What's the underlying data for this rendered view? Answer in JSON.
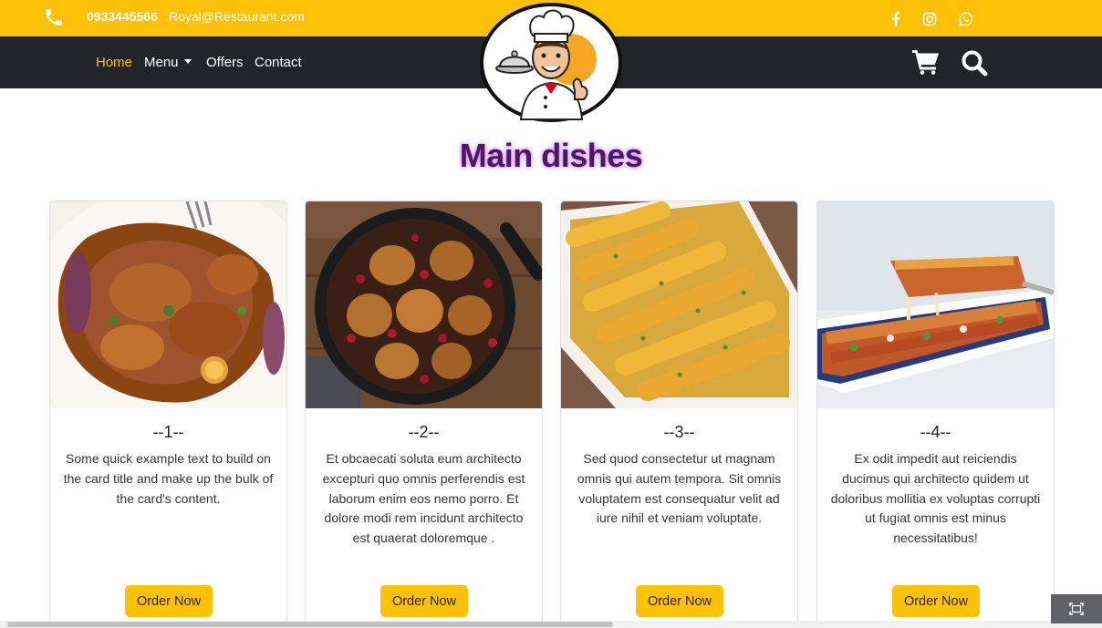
{
  "topbar": {
    "phone": "0933445566",
    "email": "Royal@Restaurant.com",
    "social_icons": [
      "facebook-icon",
      "instagram-icon",
      "whatsapp-icon"
    ]
  },
  "nav": {
    "home": "Home",
    "menu": "Menu",
    "offers": "Offers",
    "contact": "Contact"
  },
  "main": {
    "title": "Main dishes"
  },
  "cards": [
    {
      "title": "--1--",
      "text": "Some quick example text to build on the card title and make up the bulk of the card's content.",
      "button": "Order Now"
    },
    {
      "title": "--2--",
      "text": "Et obcaecati soluta eum architecto excepturi quo omnis perferendis est laborum enim eos nemo porro. Et dolore modi rem incidunt architecto est quaerat doloremque .",
      "button": "Order Now"
    },
    {
      "title": "--3--",
      "text": "Sed quod consectetur ut magnam omnis qui autem tempora. Sit omnis voluptatem est consequatur velit ad iure nihil et veniam voluptate.",
      "button": "Order Now"
    },
    {
      "title": "--4--",
      "text": "Ex odit impedit aut reiciendis ducimus qui architecto quidem ut doloribus mollitia ex voluptas corrupti ut fugiat omnis est minus necessitatibus!",
      "button": "Order Now"
    }
  ],
  "colors": {
    "accent": "#ffc107",
    "navbar": "#212529",
    "title": "#4a1a5c"
  }
}
